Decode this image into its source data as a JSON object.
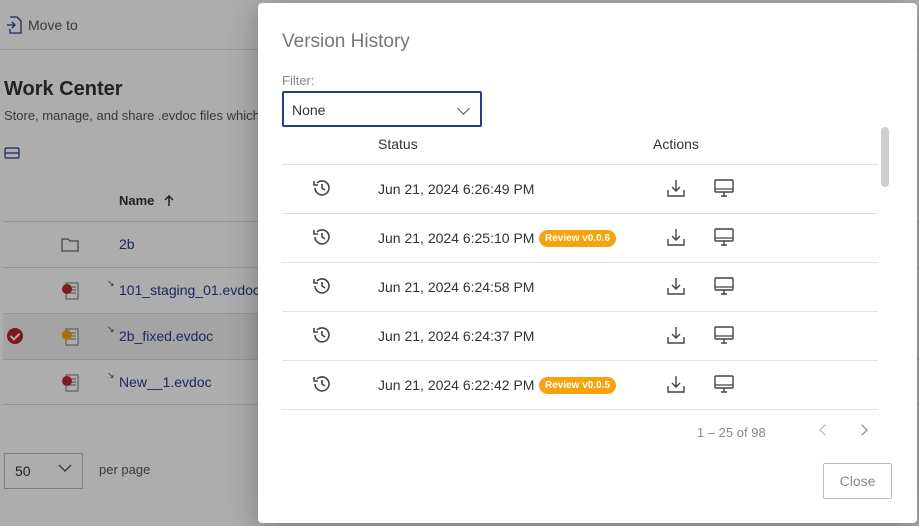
{
  "background": {
    "toolbar": {
      "move_to_label": "Move to"
    },
    "title": "Work Center",
    "subtitle": "Store, manage, and share .evdoc files which",
    "name_column": "Name",
    "files": [
      {
        "name": "2b",
        "type": "folder",
        "selected": false
      },
      {
        "name": "101_staging_01.evdoc",
        "type": "evdoc",
        "selected": false
      },
      {
        "name": "2b_fixed.evdoc",
        "type": "evdoc",
        "selected": true
      },
      {
        "name": "New__1.evdoc",
        "type": "evdoc",
        "selected": false
      }
    ],
    "per_page_value": "50",
    "per_page_label": "per page"
  },
  "dialog": {
    "title": "Version History",
    "filter_label": "Filter:",
    "filter_value": "None",
    "columns": {
      "status": "Status",
      "actions": "Actions"
    },
    "versions": [
      {
        "date": "Jun 21, 2024 6:26:49 PM",
        "badge": ""
      },
      {
        "date": "Jun 21, 2024 6:25:10 PM",
        "badge": "Review v0.0.6"
      },
      {
        "date": "Jun 21, 2024 6:24:58 PM",
        "badge": ""
      },
      {
        "date": "Jun 21, 2024 6:24:37 PM",
        "badge": ""
      },
      {
        "date": "Jun 21, 2024 6:22:42 PM",
        "badge": "Review v0.0.5"
      }
    ],
    "pagination": "1 – 25 of 98",
    "close_label": "Close",
    "colors": {
      "badge": "#f7a30f",
      "accent": "#2a3a8c"
    }
  }
}
